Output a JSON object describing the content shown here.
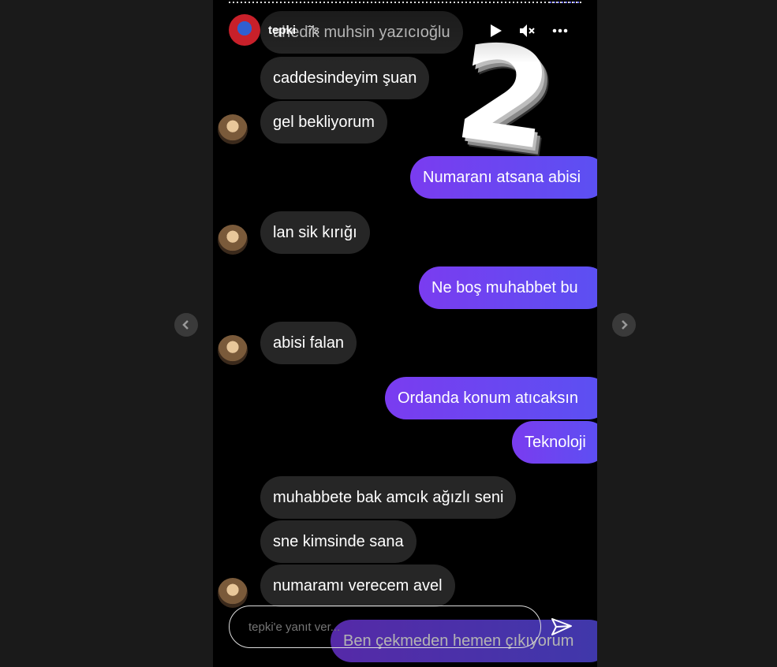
{
  "story": {
    "username": "tepki",
    "time": "7s",
    "sticker": "2",
    "reply_placeholder": "tepki'e yanıt ver...",
    "icons": {
      "play": "play-icon",
      "mute": "mute-icon",
      "more": "more-icon",
      "send": "send-icon",
      "prev": "chevron-left-icon",
      "next": "chevron-right-icon"
    }
  },
  "chat": {
    "m0": "ahedik muhsin yazıcıoğlu",
    "m1": "caddesindeyim şuan",
    "m2": "gel bekliyorum",
    "m3": "Numaranı atsana abisi",
    "m4": "lan sik kırığı",
    "m5": "Ne boş muhabbet bu",
    "m6": "abisi falan",
    "m7": "Ordanda konum atıcaksın",
    "m8": "Teknoloji",
    "m9": "muhabbete bak amcık ağızlı seni",
    "m10": "sne kimsinde sana",
    "m11": "numaramı verecem avel",
    "m12": "Ben çekmeden hemen çıkıyorum"
  },
  "colors": {
    "outgoing_start": "#7a3cf0",
    "outgoing_end": "#5a51f2",
    "incoming": "#262626",
    "page_bg": "#1a1a1a"
  }
}
